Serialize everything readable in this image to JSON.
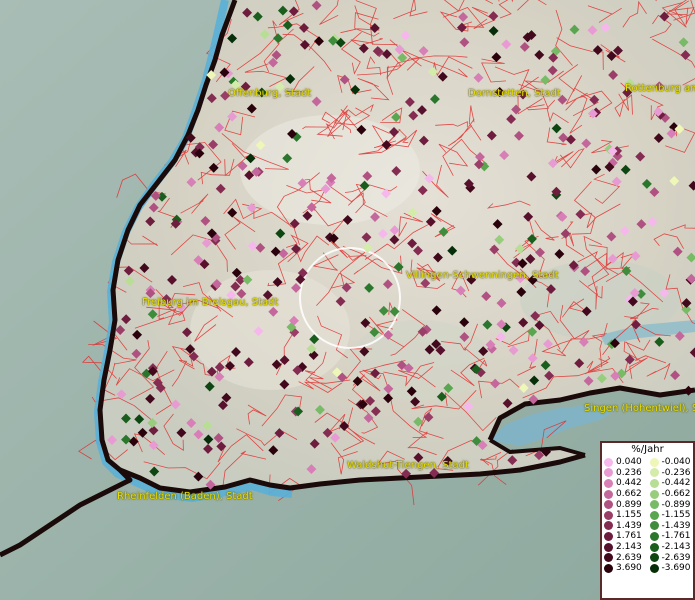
{
  "map": {
    "cities": [
      {
        "id": "offenburg",
        "label": "Offenburg, Stadt"
      },
      {
        "id": "dornstetten",
        "label": "Dornstetten, Stadt"
      },
      {
        "id": "rottenburg",
        "label": "Rottenburg am"
      },
      {
        "id": "villingen",
        "label": "Villingen-Schwenningen, Stadt"
      },
      {
        "id": "freiburg",
        "label": "Freiburg im Breisgau, Stadt"
      },
      {
        "id": "singen",
        "label": "Singen (Hohentwiel), S"
      },
      {
        "id": "waldshut",
        "label": "Waldshut-Tiengen, Stadt"
      },
      {
        "id": "rheinfelden",
        "label": "Rheinfelden (Baden), Stadt"
      }
    ],
    "colors": {
      "land": "#dcd8cc",
      "water_edge": "#5ab0d8",
      "outside": "#9fb7ad",
      "border": "#1a0a0a",
      "district_lines": "#e03030",
      "label": "#e8e000"
    }
  },
  "legend": {
    "title": "%/Jahr",
    "positive": [
      {
        "label": "0.040",
        "color": "#f6b8ec"
      },
      {
        "label": "0.236",
        "color": "#e89ad2"
      },
      {
        "label": "0.442",
        "color": "#d77fb6"
      },
      {
        "label": "0.662",
        "color": "#c4679c"
      },
      {
        "label": "0.899",
        "color": "#b05281"
      },
      {
        "label": "1.155",
        "color": "#9a3e68"
      },
      {
        "label": "1.439",
        "color": "#842c52"
      },
      {
        "label": "1.761",
        "color": "#6e1d3e"
      },
      {
        "label": "2.143",
        "color": "#58112c"
      },
      {
        "label": "2.639",
        "color": "#42081c"
      },
      {
        "label": "3.690",
        "color": "#2a020c"
      }
    ],
    "negative": [
      {
        "label": "-0.040",
        "color": "#eef6b8"
      },
      {
        "label": "-0.236",
        "color": "#d4ecaa"
      },
      {
        "label": "-0.442",
        "color": "#b8de95"
      },
      {
        "label": "-0.662",
        "color": "#98cd7d"
      },
      {
        "label": "-0.899",
        "color": "#78ba66"
      },
      {
        "label": "-1.155",
        "color": "#5aa550"
      },
      {
        "label": "-1.439",
        "color": "#3f8d3c"
      },
      {
        "label": "-1.761",
        "color": "#2a762c"
      },
      {
        "label": "-2.143",
        "color": "#1a5e1e"
      },
      {
        "label": "-2.639",
        "color": "#0e4612"
      },
      {
        "label": "-3.690",
        "color": "#062e08"
      }
    ]
  }
}
